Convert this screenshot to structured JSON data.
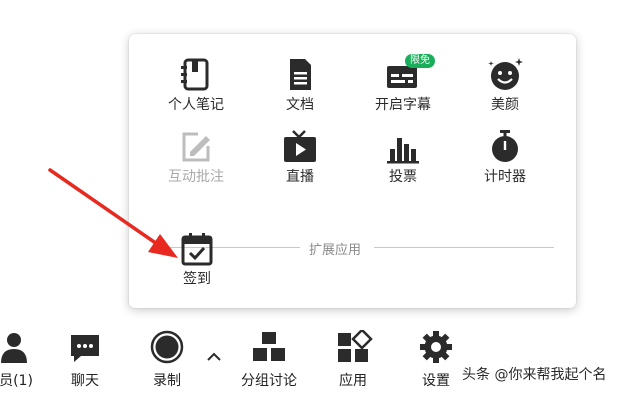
{
  "apps": [
    {
      "label": "个人笔记",
      "icon": "notebook-icon",
      "disabled": false
    },
    {
      "label": "文档",
      "icon": "document-icon",
      "disabled": false
    },
    {
      "label": "开启字幕",
      "icon": "subtitles-icon",
      "disabled": false,
      "badge": "限免"
    },
    {
      "label": "美颜",
      "icon": "beauty-face-icon",
      "disabled": false
    },
    {
      "label": "互动批注",
      "icon": "annotation-icon",
      "disabled": true
    },
    {
      "label": "直播",
      "icon": "live-tv-icon",
      "disabled": false
    },
    {
      "label": "投票",
      "icon": "vote-bar-chart-icon",
      "disabled": false
    },
    {
      "label": "计时器",
      "icon": "timer-icon",
      "disabled": false
    }
  ],
  "extension_section": {
    "title": "扩展应用",
    "items": [
      {
        "label": "签到",
        "icon": "check-in-calendar-icon"
      }
    ]
  },
  "toolbar": {
    "members": "员(1)",
    "chat": "聊天",
    "record": "录制",
    "breakout": "分组讨论",
    "apps": "应用",
    "settings": "设置"
  },
  "watermark": "头条 @你来帮我起个名",
  "colors": {
    "accent_green": "#1aad5a",
    "arrow_red": "#e8291f",
    "icon_dark": "#2b2b2b"
  }
}
